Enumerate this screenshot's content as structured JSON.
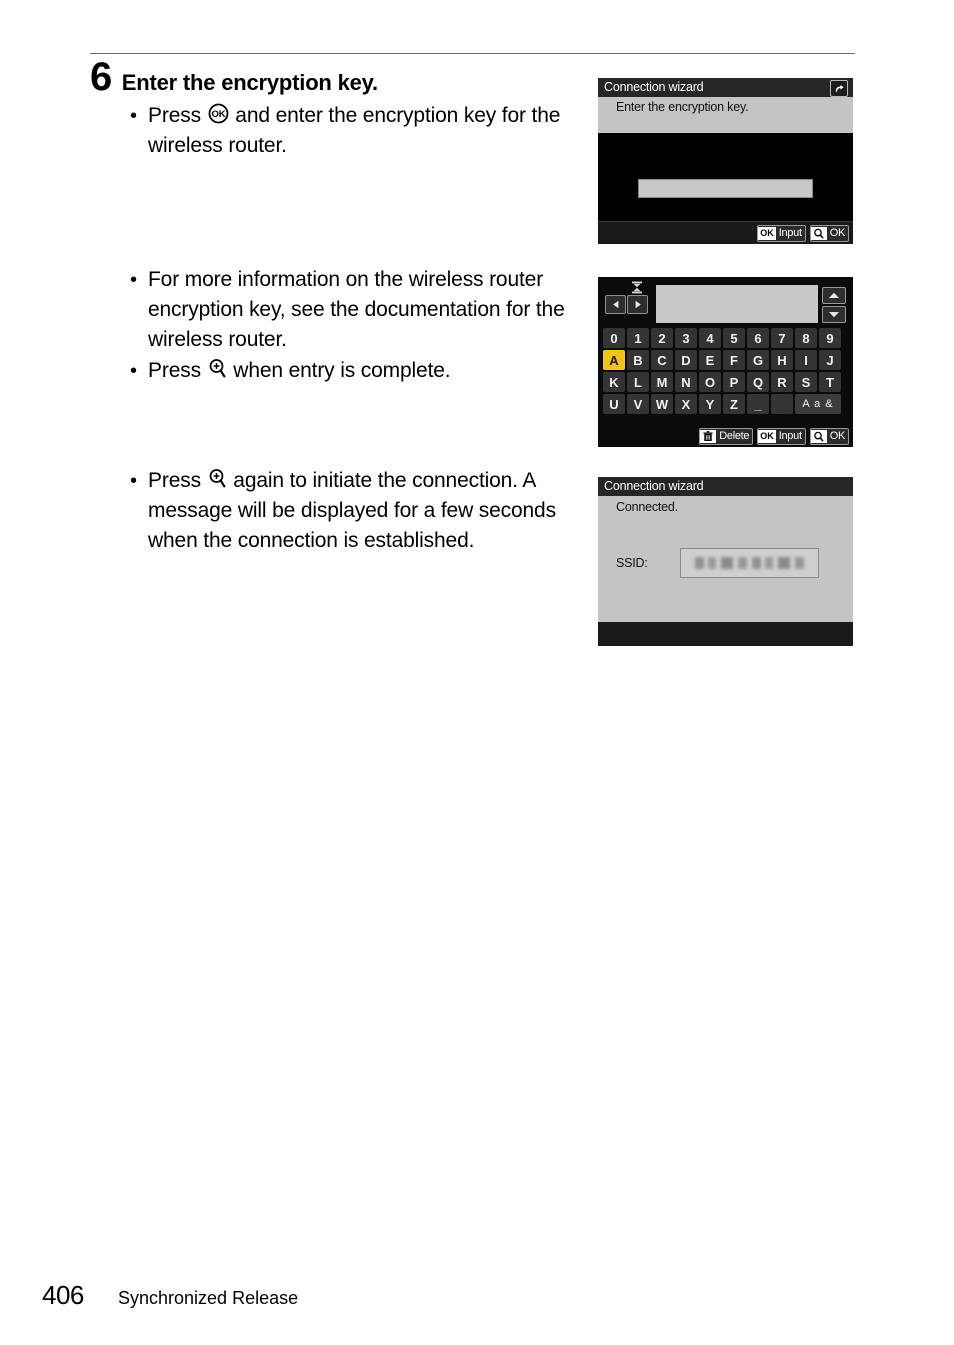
{
  "page": {
    "folio": "406",
    "running_head": "Synchronized Release"
  },
  "step": {
    "number": "6",
    "title": "Enter the encryption key."
  },
  "bullets": {
    "group1": [
      {
        "before": "Press ",
        "icon": "ok-button-icon",
        "after": " and enter the encryption key for the wireless router."
      }
    ],
    "group2": [
      {
        "before": "For more information on the wireless router encryption key, see the documentation for the wireless router.",
        "icon": "",
        "after": ""
      },
      {
        "before": "Press ",
        "icon": "zoom-in-button-icon",
        "after": " when entry is complete."
      }
    ],
    "group3": [
      {
        "before": "Press ",
        "icon": "zoom-in-button-icon",
        "after": " again to initiate the connection. A message will be displayed for a few seconds when the connection is established."
      }
    ]
  },
  "screens": {
    "screen1": {
      "title": "Connection wizard",
      "back_icon": "back-arrow-icon",
      "message": "Enter the encryption key.",
      "entry_value": "",
      "hints": [
        {
          "badge_text": "OK",
          "badge_icon": "",
          "label": "Input"
        },
        {
          "badge_text": "",
          "badge_icon": "magnifier-icon",
          "label": "OK"
        }
      ]
    },
    "screen2": {
      "cursor_icon": "text-cursor-icon",
      "nav_left_icon": "arrow-left-icon",
      "nav_right_icon": "arrow-right-icon",
      "scroll_up_icon": "arrow-up-icon",
      "scroll_down_icon": "arrow-down-icon",
      "field_value": "",
      "selected_key": "A",
      "keys": [
        [
          "0",
          "1",
          "2",
          "3",
          "4",
          "5",
          "6",
          "7",
          "8",
          "9"
        ],
        [
          "A",
          "B",
          "C",
          "D",
          "E",
          "F",
          "G",
          "H",
          "I",
          "J"
        ],
        [
          "K",
          "L",
          "M",
          "N",
          "O",
          "P",
          "Q",
          "R",
          "S",
          "T"
        ],
        [
          "U",
          "V",
          "W",
          "X",
          "Y",
          "Z",
          "_",
          " "
        ]
      ],
      "mode_key": "A a &",
      "hints": [
        {
          "badge_text": "",
          "badge_icon": "trash-icon",
          "label": "Delete"
        },
        {
          "badge_text": "OK",
          "badge_icon": "",
          "label": "Input"
        },
        {
          "badge_text": "",
          "badge_icon": "magnifier-icon",
          "label": "OK"
        }
      ]
    },
    "screen3": {
      "title": "Connection wizard",
      "message": "Connected.",
      "ssid_label": "SSID:",
      "ssid_value": ""
    }
  },
  "colors": {
    "key_selected": "#f0c419",
    "screen_gray": "#c4c4c4",
    "screen_black": "#000000"
  }
}
